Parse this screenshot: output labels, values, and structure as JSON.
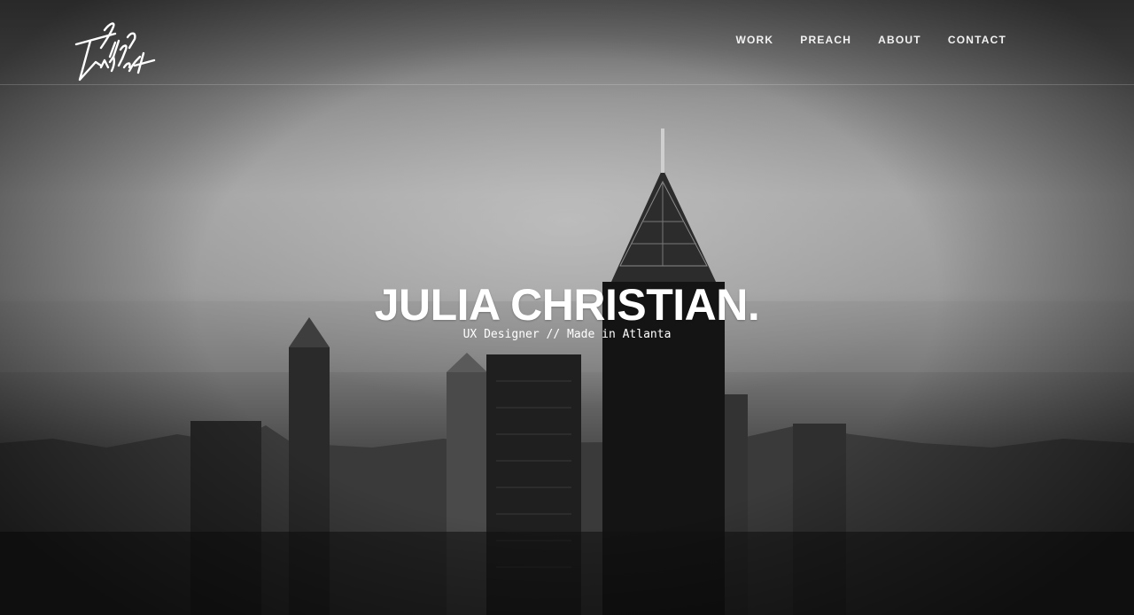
{
  "site": {
    "logo_text": "Julia Christ"
  },
  "nav": {
    "items": [
      {
        "label": "WORK"
      },
      {
        "label": "PREACH"
      },
      {
        "label": "ABOUT"
      },
      {
        "label": "CONTACT"
      }
    ]
  },
  "hero": {
    "title": "JULIA CHRISTIAN.",
    "subtitle": "UX Designer // Made in Atlanta",
    "background": "black-and-white city skyline in fog"
  }
}
